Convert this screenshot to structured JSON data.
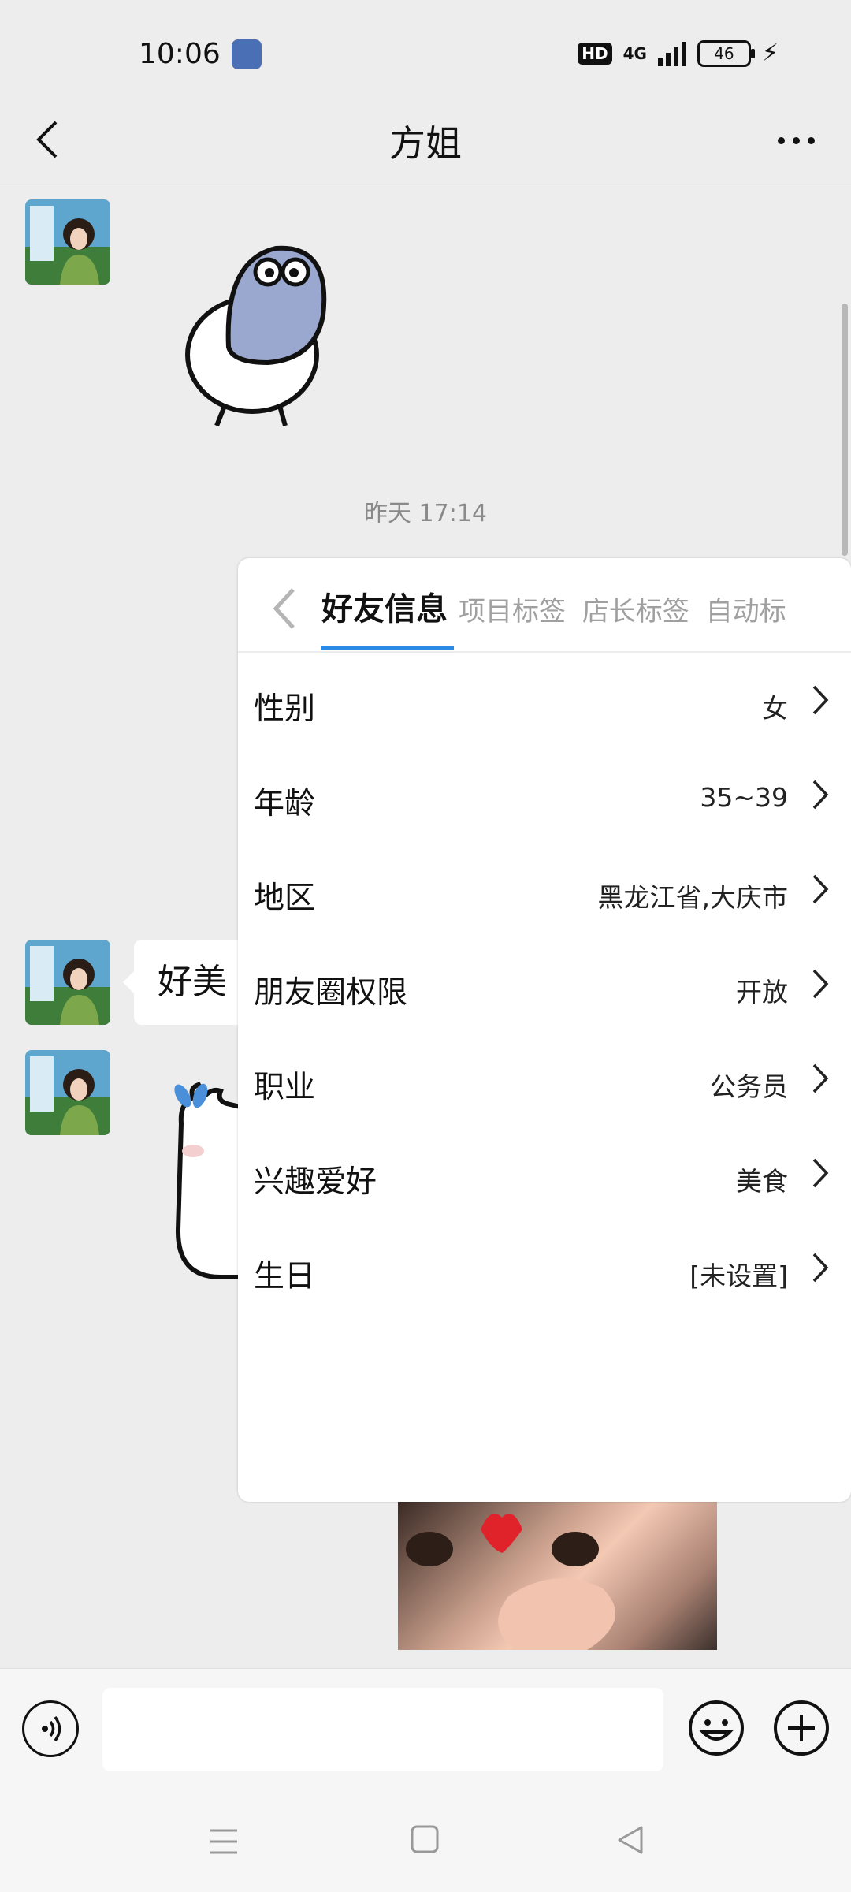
{
  "status_bar": {
    "time": "10:06",
    "hd": "HD",
    "network": "4G",
    "battery": "46"
  },
  "header": {
    "title": "方姐",
    "back_icon": "chevron-left-icon",
    "more_icon": "more-dots-icon"
  },
  "chat": {
    "timestamp": "昨天 17:14",
    "bubble_text": "好美"
  },
  "popup": {
    "active_tab": "好友信息",
    "other_tabs": [
      "项目标签",
      "店长标签",
      "自动标"
    ],
    "accent_color": "#2b8ae6",
    "rows": [
      {
        "label": "性别",
        "value": "女"
      },
      {
        "label": "年龄",
        "value": "35~39"
      },
      {
        "label": "地区",
        "value": "黑龙江省,大庆市"
      },
      {
        "label": "朋友圈权限",
        "value": "开放"
      },
      {
        "label": "职业",
        "value": "公务员"
      },
      {
        "label": "兴趣爱好",
        "value": "美食"
      },
      {
        "label": "生日",
        "value": "[未设置]"
      }
    ]
  },
  "input_bar": {
    "voice_icon": "voice-icon",
    "emoji_icon": "emoji-icon",
    "plus_icon": "plus-icon"
  }
}
